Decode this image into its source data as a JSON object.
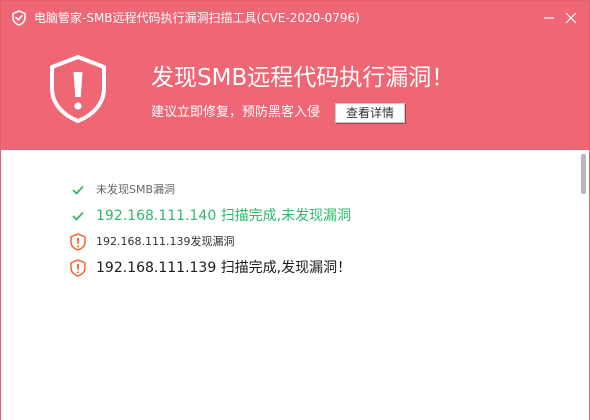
{
  "window": {
    "title": "电脑管家-SMB远程代码执行漏洞扫描工具(CVE-2020-0796)"
  },
  "banner": {
    "headline": "发现SMB远程代码执行漏洞！",
    "subline": "建议立即修复，预防黑客入侵",
    "details_button": "查看详情",
    "shield_icon": "warning-shield-icon"
  },
  "results": [
    {
      "text": "未发现SMB漏洞",
      "status": "ok",
      "icon": "check-icon"
    },
    {
      "text": "192.168.111.140 扫描完成,未发现漏洞",
      "status": "ok",
      "icon": "check-icon"
    },
    {
      "text": "192.168.111.139发现漏洞",
      "status": "vulnerable",
      "icon": "warning-shield-icon"
    },
    {
      "text": "192.168.111.139 扫描完成,发现漏洞！",
      "status": "vulnerable",
      "icon": "warning-shield-icon"
    }
  ],
  "colors": {
    "header_bg": "#ef6675",
    "ok_green": "#2bba6a",
    "warning_orange": "#f26a35"
  }
}
